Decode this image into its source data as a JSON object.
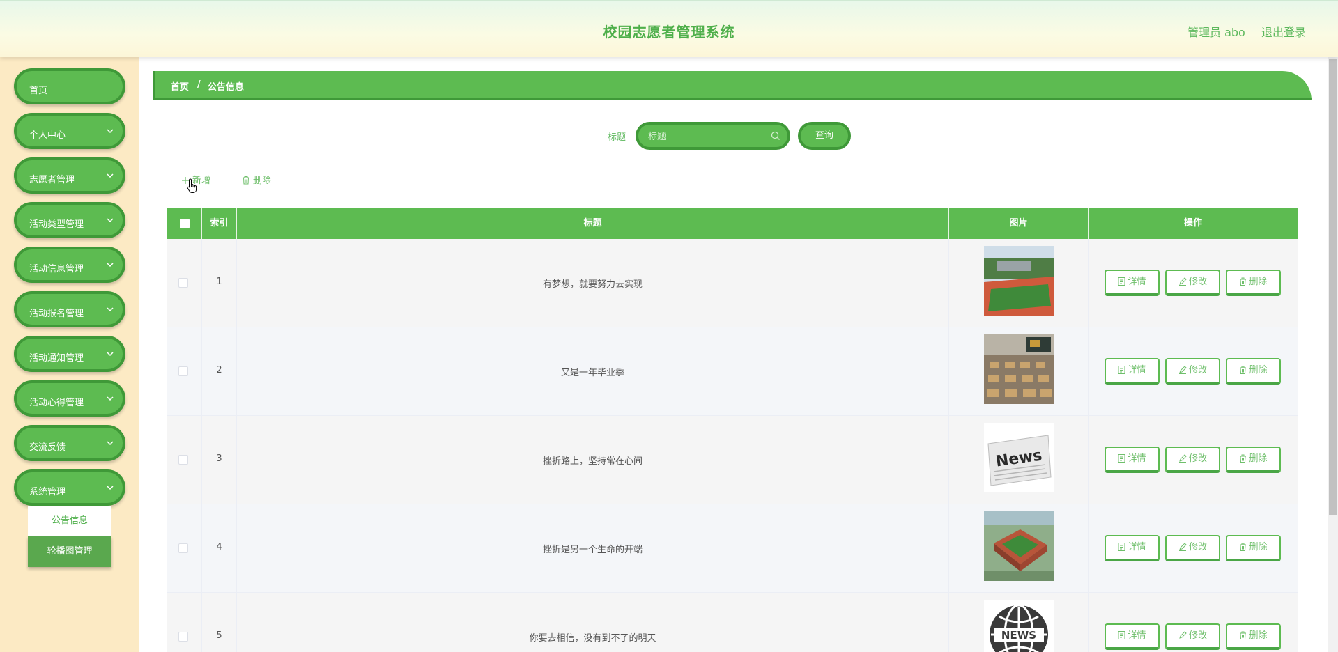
{
  "header": {
    "title": "校园志愿者管理系统",
    "user": "管理员 abo",
    "logout": "退出登录"
  },
  "sidebar": {
    "items": [
      {
        "label": "首页",
        "has_children": false
      },
      {
        "label": "个人中心",
        "has_children": true
      },
      {
        "label": "志愿者管理",
        "has_children": true
      },
      {
        "label": "活动类型管理",
        "has_children": true
      },
      {
        "label": "活动信息管理",
        "has_children": true
      },
      {
        "label": "活动报名管理",
        "has_children": true
      },
      {
        "label": "活动通知管理",
        "has_children": true
      },
      {
        "label": "活动心得管理",
        "has_children": true
      },
      {
        "label": "交流反馈",
        "has_children": true
      },
      {
        "label": "系统管理",
        "has_children": true
      }
    ],
    "submenu": [
      {
        "label": "公告信息",
        "active": true
      },
      {
        "label": "轮播图管理",
        "active": false
      }
    ]
  },
  "breadcrumb": {
    "home": "首页",
    "separator": "/",
    "current": "公告信息"
  },
  "search": {
    "label": "标题",
    "placeholder": "标题",
    "value": "",
    "button": "查询"
  },
  "actions": {
    "add": "新增",
    "delete": "删除"
  },
  "table": {
    "columns": [
      "索引",
      "标题",
      "图片",
      "操作"
    ],
    "rows": [
      {
        "index": "1",
        "title": "有梦想，就要努力去实现",
        "image": "campus-track"
      },
      {
        "index": "2",
        "title": "又是一年毕业季",
        "image": "classroom"
      },
      {
        "index": "3",
        "title": "挫折路上，坚持常在心间",
        "image": "newspaper"
      },
      {
        "index": "4",
        "title": "挫折是另一个生命的开端",
        "image": "stadium"
      },
      {
        "index": "5",
        "title": "你要去相信，没有到不了的明天",
        "image": "news-globe"
      }
    ],
    "ops": {
      "detail": "详情",
      "edit": "修改",
      "delete": "删除"
    }
  },
  "colors": {
    "accent": "#5dbb51",
    "accent_dark": "#3f9938",
    "sidebar_bg": "#fceac4"
  }
}
